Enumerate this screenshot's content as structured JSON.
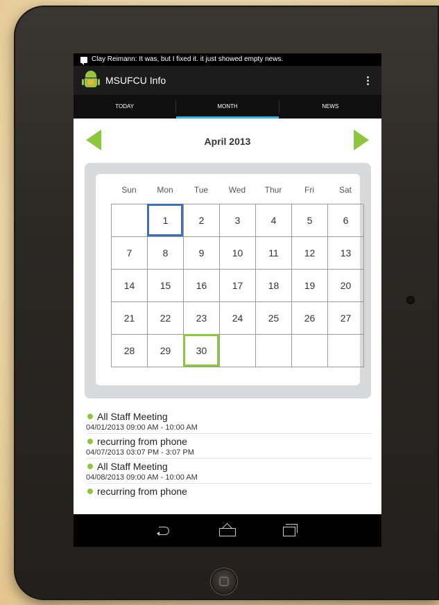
{
  "status_bar": {
    "notification": "Clay Reimann: It was, but I fixed it. it just showed empty news."
  },
  "action_bar": {
    "title": "MSUFCU Info"
  },
  "tabs": [
    {
      "label": "TODAY",
      "active": false
    },
    {
      "label": "MONTH",
      "active": true
    },
    {
      "label": "NEWS",
      "active": false
    }
  ],
  "calendar": {
    "month_label": "April 2013",
    "weekdays": [
      "Sun",
      "Mon",
      "Tue",
      "Wed",
      "Thur",
      "Fri",
      "Sat"
    ],
    "weeks": [
      [
        "",
        "1",
        "2",
        "3",
        "4",
        "5",
        "6"
      ],
      [
        "7",
        "8",
        "9",
        "10",
        "11",
        "12",
        "13"
      ],
      [
        "14",
        "15",
        "16",
        "17",
        "18",
        "19",
        "20"
      ],
      [
        "21",
        "22",
        "23",
        "24",
        "25",
        "26",
        "27"
      ],
      [
        "28",
        "29",
        "30",
        "",
        "",
        "",
        ""
      ]
    ],
    "today_day": "1",
    "selected_day": "30",
    "accent_color": "#8dc63f",
    "today_color": "#3e6fb8"
  },
  "events": [
    {
      "title": "All Staff Meeting",
      "time": "04/01/2013   09:00 AM - 10:00 AM"
    },
    {
      "title": "recurring from phone",
      "time": "04/07/2013   03:07 PM - 3:07 PM"
    },
    {
      "title": "All Staff Meeting",
      "time": "04/08/2013   09:00 AM - 10:00 AM"
    },
    {
      "title": "recurring from phone",
      "time": ""
    }
  ]
}
